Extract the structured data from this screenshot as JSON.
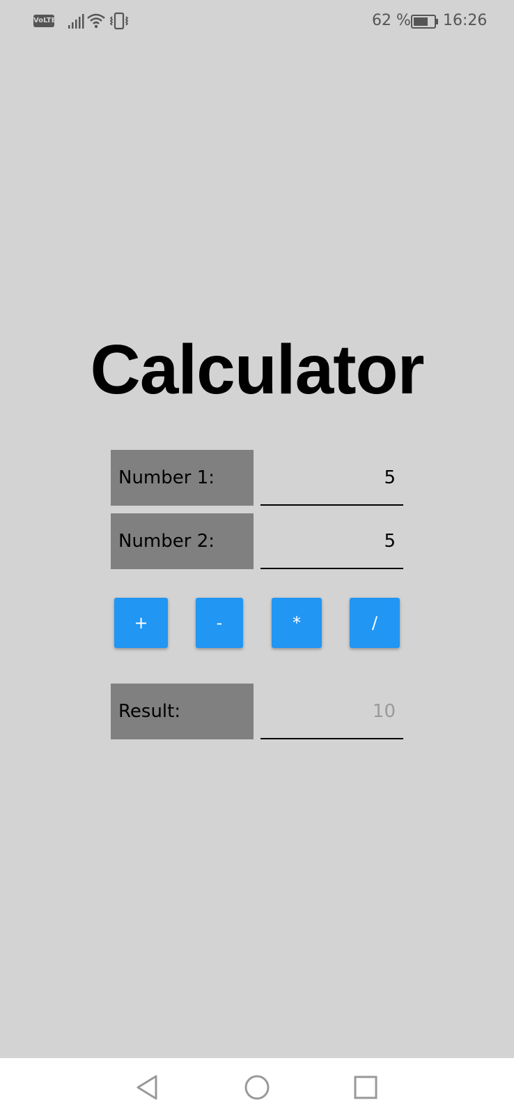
{
  "status_bar": {
    "volte_label": "VoLTE",
    "battery_percent": "62 %",
    "time": "16:26",
    "icons": [
      "volte-icon",
      "signal-icon",
      "wifi-icon",
      "vibrate-icon",
      "battery-icon"
    ]
  },
  "title": "Calculator",
  "form": {
    "number1_label": "Number 1:",
    "number1_value": "5",
    "number2_label": "Number 2:",
    "number2_value": "5",
    "result_label": "Result:",
    "result_value": "10"
  },
  "operators": {
    "add": "+",
    "subtract": "-",
    "multiply": "*",
    "divide": "/"
  },
  "nav_bar": {
    "icons": [
      "back-icon",
      "home-icon",
      "recents-icon"
    ]
  },
  "colors": {
    "background": "#d3d3d3",
    "label_box": "#808080",
    "button": "#2196f3",
    "result_text": "#9a9a9a"
  }
}
